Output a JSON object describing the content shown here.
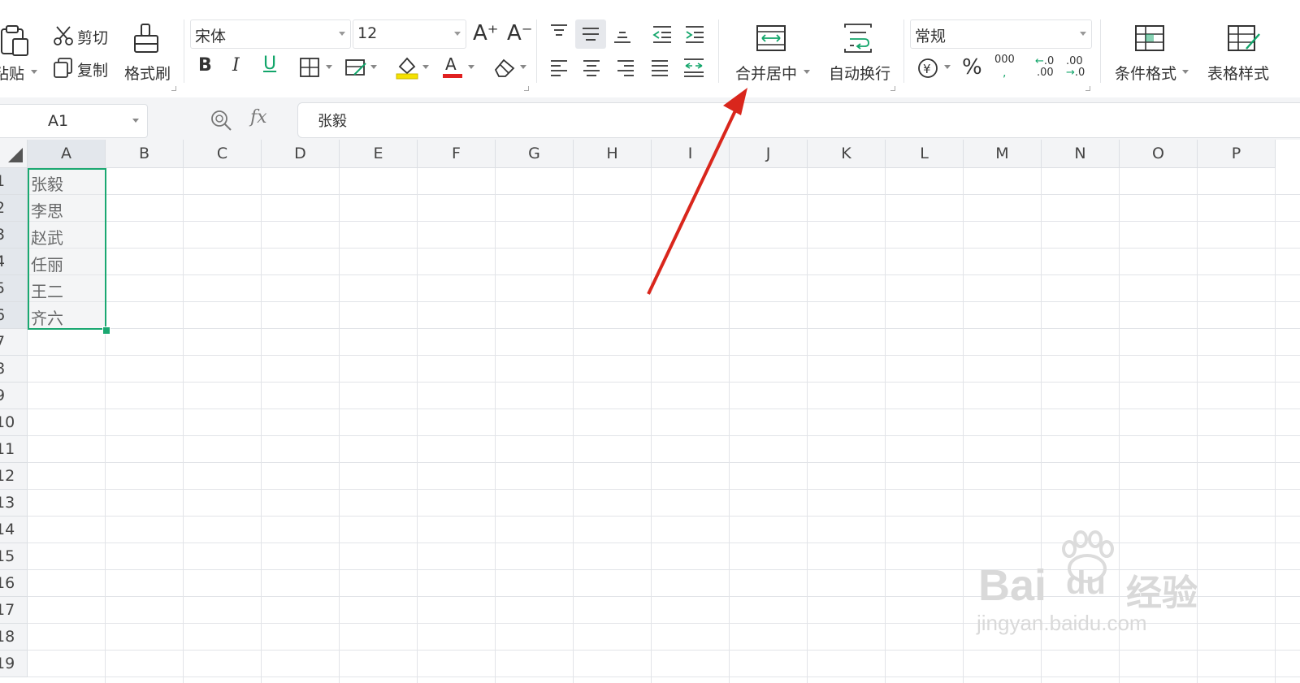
{
  "ribbon": {
    "paste_label": "粘贴",
    "cut_label": "剪切",
    "copy_label": "复制",
    "format_painter_label": "格式刷",
    "font_name": "宋体",
    "font_size": "12",
    "bold_glyph": "B",
    "italic_glyph": "I",
    "underline_glyph": "U",
    "increase_font_glyph": "A⁺",
    "decrease_font_glyph": "A⁻",
    "merge_center_label": "合并居中",
    "wrap_text_label": "自动换行",
    "number_format": "常规",
    "percent_glyph": "%",
    "thousands_glyph": "000",
    "increase_decimal_glyph": ".00",
    "decrease_decimal_glyph": ".00",
    "conditional_format_label": "条件格式",
    "table_style_label": "表格样式",
    "accent_green": "#12a56a",
    "font_color_red": "#e02020",
    "fill_yellow": "#f5e100"
  },
  "formula_bar": {
    "name_box": "A1",
    "fx_label": "fx",
    "content": "张毅"
  },
  "sheet": {
    "columns": [
      "A",
      "B",
      "C",
      "D",
      "E",
      "F",
      "G",
      "H",
      "I",
      "J",
      "K",
      "L",
      "M",
      "N",
      "O",
      "P"
    ],
    "rows": [
      "1",
      "2",
      "3",
      "4",
      "5",
      "6",
      "7",
      "8",
      "9",
      "10",
      "11",
      "12",
      "13",
      "14",
      "15",
      "16",
      "17",
      "18",
      "19"
    ],
    "column_a_values": [
      "张毅",
      "李思",
      "赵武",
      "任丽",
      "王二",
      "齐六"
    ],
    "selection_color": "#1aa871"
  },
  "annotation": {
    "arrow_color": "#d9261c"
  },
  "watermark": {
    "brand": "Bai",
    "brand_suffix": "du",
    "brand_cn": "经验",
    "url": "jingyan.baidu.com"
  }
}
